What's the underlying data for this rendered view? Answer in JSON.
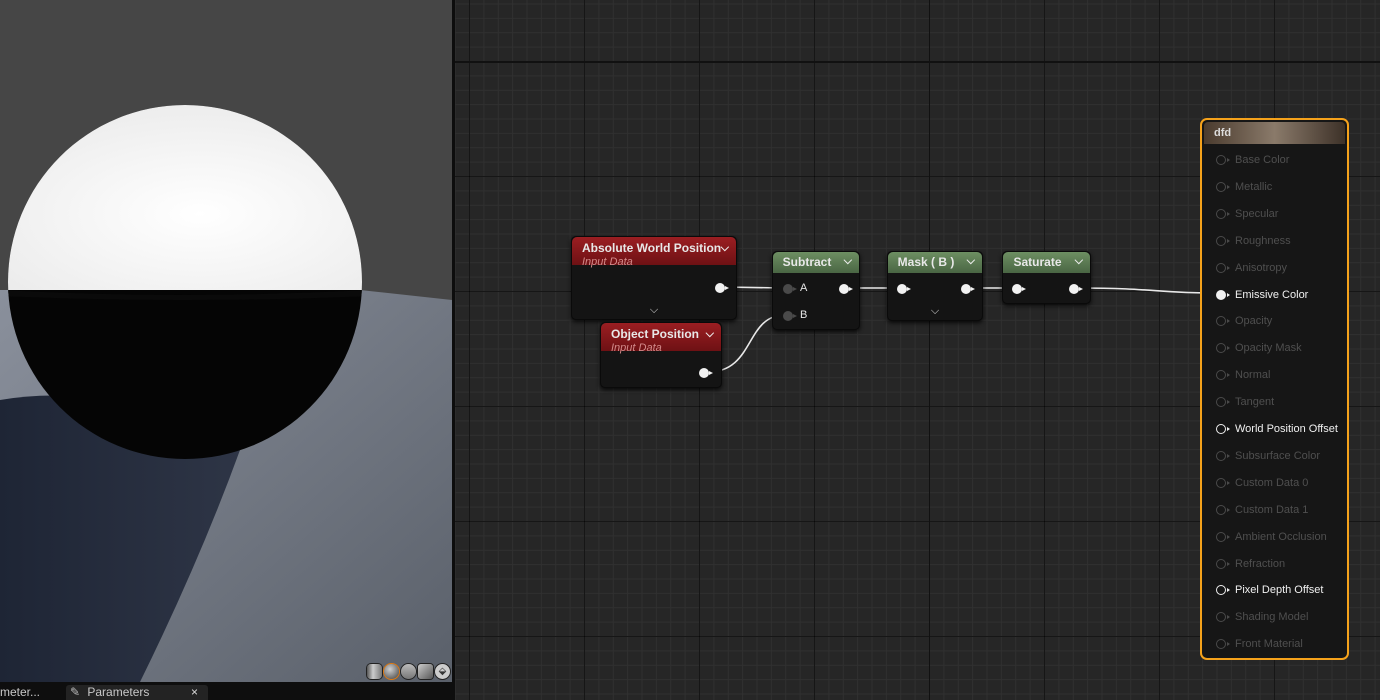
{
  "viewport": {
    "preview_shapes": [
      "cylinder",
      "sphere",
      "plane",
      "cube",
      "custom-mesh"
    ],
    "selected_shape": "sphere"
  },
  "bottom_tabs": {
    "left_tab_label": "meter...",
    "active_tab_label": "Parameters",
    "close_glyph": "×",
    "pen_glyph": "✎"
  },
  "graph": {
    "nodes": {
      "absolute_world_position": {
        "title": "Absolute World Position",
        "subtitle": "Input Data",
        "chevron": "⌄"
      },
      "object_position": {
        "title": "Object Position",
        "subtitle": "Input Data",
        "chevron": "⌄"
      },
      "subtract": {
        "title": "Subtract",
        "chevron": "⌄",
        "input_a": "A",
        "input_b": "B"
      },
      "mask": {
        "title": "Mask ( B )",
        "chevron": "⌄"
      },
      "saturate": {
        "title": "Saturate",
        "chevron": "⌄"
      }
    },
    "result_node": {
      "title": "dfd",
      "inputs": [
        {
          "label": "Base Color",
          "state": "inactive"
        },
        {
          "label": "Metallic",
          "state": "inactive"
        },
        {
          "label": "Specular",
          "state": "inactive"
        },
        {
          "label": "Roughness",
          "state": "inactive"
        },
        {
          "label": "Anisotropy",
          "state": "inactive"
        },
        {
          "label": "Emissive Color",
          "state": "connected"
        },
        {
          "label": "Opacity",
          "state": "inactive"
        },
        {
          "label": "Opacity Mask",
          "state": "inactive"
        },
        {
          "label": "Normal",
          "state": "inactive"
        },
        {
          "label": "Tangent",
          "state": "inactive"
        },
        {
          "label": "World Position Offset",
          "state": "active"
        },
        {
          "label": "Subsurface Color",
          "state": "inactive"
        },
        {
          "label": "Custom Data 0",
          "state": "inactive"
        },
        {
          "label": "Custom Data 1",
          "state": "inactive"
        },
        {
          "label": "Ambient Occlusion",
          "state": "inactive"
        },
        {
          "label": "Refraction",
          "state": "inactive"
        },
        {
          "label": "Pixel Depth Offset",
          "state": "active"
        },
        {
          "label": "Shading Model",
          "state": "inactive"
        },
        {
          "label": "Front Material",
          "state": "inactive"
        }
      ]
    },
    "accent_color": "#f5a21b"
  }
}
